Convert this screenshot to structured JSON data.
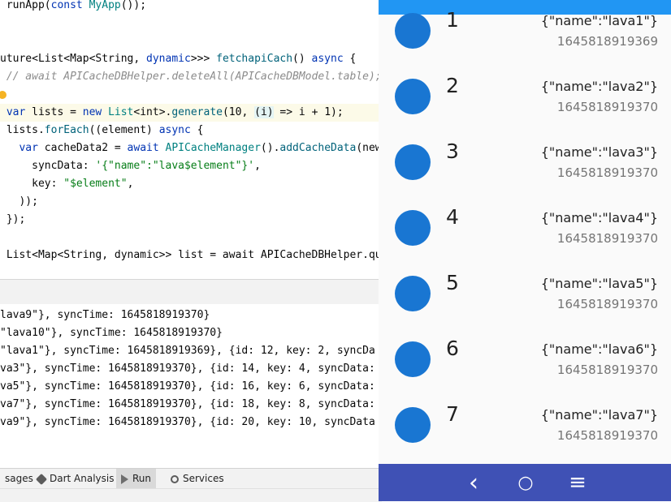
{
  "editor": {
    "lines": [
      {
        "parts": [
          {
            "t": " runApp(",
            "c": ""
          },
          {
            "t": "const ",
            "c": "kw"
          },
          {
            "t": "MyApp",
            "c": "cls"
          },
          {
            "t": "());",
            "c": ""
          }
        ]
      },
      {
        "parts": []
      },
      {
        "parts": []
      },
      {
        "parts": [
          {
            "t": "uture<List<Map<String, ",
            "c": ""
          },
          {
            "t": "dynamic",
            "c": "kw"
          },
          {
            "t": ">>> ",
            "c": ""
          },
          {
            "t": "fetchapiCach",
            "c": "fn"
          },
          {
            "t": "() ",
            "c": ""
          },
          {
            "t": "async",
            "c": "kw"
          },
          {
            "t": " {",
            "c": ""
          }
        ]
      },
      {
        "parts": [
          {
            "t": " // await APICacheDBHelper.deleteAll(APICacheDBModel.table);",
            "c": "cm"
          }
        ]
      },
      {
        "parts": []
      },
      {
        "parts": [
          {
            "t": " var ",
            "c": "kw"
          },
          {
            "t": "lists = ",
            "c": ""
          },
          {
            "t": "new ",
            "c": "kw"
          },
          {
            "t": "List",
            "c": "cls"
          },
          {
            "t": "<int>.",
            "c": ""
          },
          {
            "t": "generate",
            "c": "fn"
          },
          {
            "t": "(10, ",
            "c": ""
          },
          {
            "t": "(i)",
            "c": "param-hl"
          },
          {
            "t": " => i + 1);",
            "c": ""
          }
        ],
        "highlight": true
      },
      {
        "parts": [
          {
            "t": " lists.",
            "c": ""
          },
          {
            "t": "forEach",
            "c": "fn"
          },
          {
            "t": "((element) ",
            "c": ""
          },
          {
            "t": "async",
            "c": "kw"
          },
          {
            "t": " {",
            "c": ""
          }
        ]
      },
      {
        "parts": [
          {
            "t": "   var ",
            "c": "kw"
          },
          {
            "t": "cacheData2 = ",
            "c": ""
          },
          {
            "t": "await ",
            "c": "kw"
          },
          {
            "t": "APICacheManager",
            "c": "cls"
          },
          {
            "t": "().",
            "c": ""
          },
          {
            "t": "addCacheData",
            "c": "fn"
          },
          {
            "t": "(new",
            "c": ""
          }
        ]
      },
      {
        "parts": [
          {
            "t": "     syncData: ",
            "c": ""
          },
          {
            "t": "'{\"name\":\"lava$element\"}'",
            "c": "str"
          },
          {
            "t": ",",
            "c": ""
          }
        ]
      },
      {
        "parts": [
          {
            "t": "     key: ",
            "c": ""
          },
          {
            "t": "\"$element\"",
            "c": "str"
          },
          {
            "t": ",",
            "c": ""
          }
        ]
      },
      {
        "parts": [
          {
            "t": "   ));",
            "c": ""
          }
        ]
      },
      {
        "parts": [
          {
            "t": " });",
            "c": ""
          }
        ]
      },
      {
        "parts": []
      },
      {
        "parts": [
          {
            "t": " List<Map<String, dynamic>> list = await APICacheDBHelper.query",
            "c": ""
          }
        ]
      }
    ]
  },
  "console": {
    "lines": [
      "lava9\"}, syncTime: 1645818919370}",
      "\"lava10\"}, syncTime: 1645818919370}",
      "\"lava1\"}, syncTime: 1645818919369}, {id: 12, key: 2, syncDa",
      "va3\"}, syncTime: 1645818919370}, {id: 14, key: 4, syncData:",
      "va5\"}, syncTime: 1645818919370}, {id: 16, key: 6, syncData:",
      "va7\"}, syncTime: 1645818919370}, {id: 18, key: 8, syncData:",
      "va9\"}, syncTime: 1645818919370}, {id: 20, key: 10, syncData"
    ]
  },
  "bottom_tabs": [
    {
      "label": "sages",
      "icon": ""
    },
    {
      "label": "Dart Analysis",
      "icon": "dart-icon"
    },
    {
      "label": "Run",
      "icon": "run-icon",
      "active": true
    },
    {
      "label": "Services",
      "icon": "services-icon"
    }
  ],
  "phone": {
    "items": [
      {
        "number": "1",
        "json": "{\"name\":\"lava1\"}",
        "timestamp": "1645818919369"
      },
      {
        "number": "2",
        "json": "{\"name\":\"lava2\"}",
        "timestamp": "1645818919370"
      },
      {
        "number": "3",
        "json": "{\"name\":\"lava3\"}",
        "timestamp": "1645818919370"
      },
      {
        "number": "4",
        "json": "{\"name\":\"lava4\"}",
        "timestamp": "1645818919370"
      },
      {
        "number": "5",
        "json": "{\"name\":\"lava5\"}",
        "timestamp": "1645818919370"
      },
      {
        "number": "6",
        "json": "{\"name\":\"lava6\"}",
        "timestamp": "1645818919370"
      },
      {
        "number": "7",
        "json": "{\"name\":\"lava7\"}",
        "timestamp": "1645818919370"
      }
    ],
    "nav": {
      "back": "‹",
      "home": "○",
      "menu": "≡"
    },
    "colors": {
      "appbar": "#2196f3",
      "avatar": "#1976d2",
      "navbar": "#3f51b5"
    }
  }
}
